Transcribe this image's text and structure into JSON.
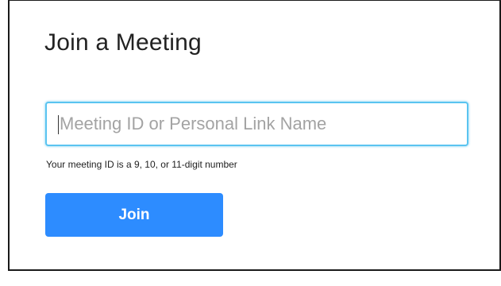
{
  "dialog": {
    "title": "Join a Meeting",
    "meeting_id_input": {
      "value": "",
      "placeholder": "Meeting ID or Personal Link Name"
    },
    "hint": "Your meeting ID is a 9, 10, or 11-digit number",
    "join_label": "Join"
  },
  "colors": {
    "accent": "#2d8cff",
    "focus_border": "#5ac4f0",
    "text": "#222222",
    "placeholder": "#a3a3a3"
  }
}
